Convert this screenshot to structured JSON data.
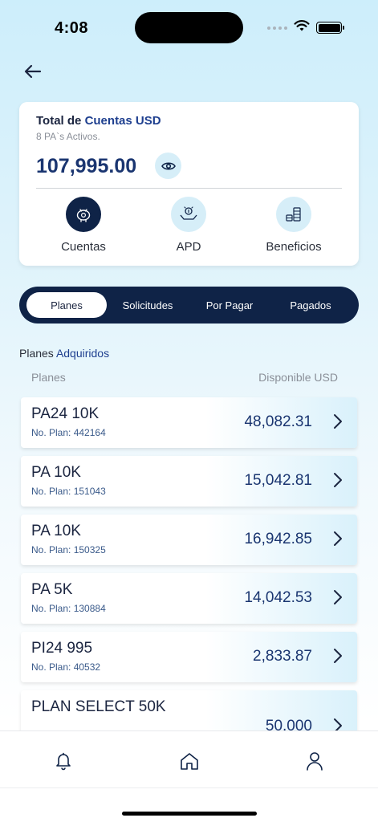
{
  "status_bar": {
    "time": "4:08"
  },
  "summary": {
    "title_prefix": "Total de ",
    "title_accent": "Cuentas USD",
    "subtitle": "8 PA`s Activos.",
    "amount": "107,995.00",
    "eye_icon": "eye-icon",
    "actions": [
      {
        "label": "Cuentas",
        "icon": "piggy-bank-icon"
      },
      {
        "label": "APD",
        "icon": "hand-coin-icon"
      },
      {
        "label": "Beneficios",
        "icon": "coins-stack-icon"
      }
    ]
  },
  "tabs": [
    {
      "label": "Planes",
      "active": true
    },
    {
      "label": "Solicitudes",
      "active": false
    },
    {
      "label": "Por Pagar",
      "active": false
    },
    {
      "label": "Pagados",
      "active": false
    }
  ],
  "section": {
    "title_prefix": "Planes ",
    "title_accent": "Adquiridos",
    "col_left": "Planes",
    "col_right": "Disponible USD"
  },
  "plans": [
    {
      "name": "PA24 10K",
      "number": "No. Plan: 442164",
      "amount": "48,082.31"
    },
    {
      "name": "PA 10K",
      "number": "No. Plan: 151043",
      "amount": "15,042.81"
    },
    {
      "name": "PA 10K",
      "number": "No. Plan: 150325",
      "amount": "16,942.85"
    },
    {
      "name": "PA 5K",
      "number": "No. Plan: 130884",
      "amount": "14,042.53"
    },
    {
      "name": "PI24 995",
      "number": "No. Plan: 40532",
      "amount": "2,833.87"
    },
    {
      "name": "PLAN SELECT 50K",
      "number": "",
      "amount": "50,000"
    }
  ],
  "bottom_nav": [
    {
      "icon": "bell-icon"
    },
    {
      "icon": "home-icon"
    },
    {
      "icon": "user-icon"
    }
  ],
  "colors": {
    "navy": "#0f2347",
    "accent": "#1e3f8f",
    "light_blue": "#d6eef8"
  }
}
